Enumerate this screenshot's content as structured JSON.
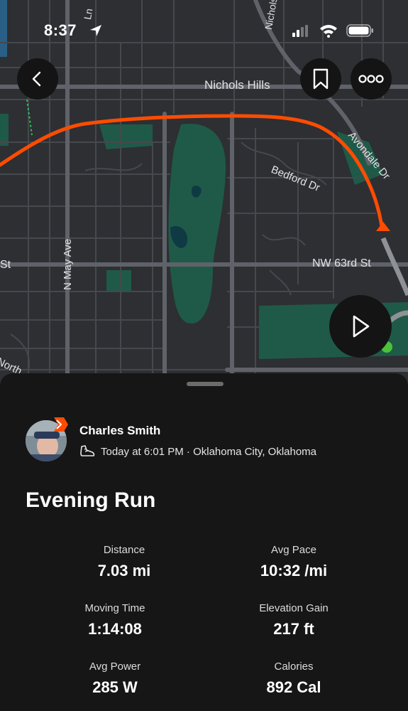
{
  "status_bar": {
    "time": "8:37"
  },
  "map": {
    "labels": {
      "nichols_hills": "Nichols Hills",
      "nichols_rd": "Nichols R",
      "avondale_dr": "Avondale Dr",
      "bedford_dr": "Bedford Dr",
      "nw_63rd_st": "NW 63rd St",
      "n_may_ave": "N May Ave",
      "st_left": "St",
      "north_left": "North",
      "ln_top": "Ln"
    },
    "route_color": "#fc4c02",
    "water_color": "#1c5a4a"
  },
  "header": {
    "back_icon": "chevron-left-icon",
    "bookmark_icon": "bookmark-icon",
    "more_icon": "more-horizontal-icon"
  },
  "play_icon": "play-icon",
  "activity": {
    "athlete_name": "Charles Smith",
    "meta": "Today at 6:01 PM · Oklahoma City, Oklahoma",
    "sport_icon": "shoe-icon",
    "title": "Evening Run",
    "stats": [
      {
        "label": "Distance",
        "value": "7.03 mi"
      },
      {
        "label": "Avg Pace",
        "value": "10:32 /mi"
      },
      {
        "label": "Moving Time",
        "value": "1:14:08"
      },
      {
        "label": "Elevation Gain",
        "value": "217 ft"
      },
      {
        "label": "Avg Power",
        "value": "285 W"
      },
      {
        "label": "Calories",
        "value": "892 Cal"
      }
    ]
  }
}
